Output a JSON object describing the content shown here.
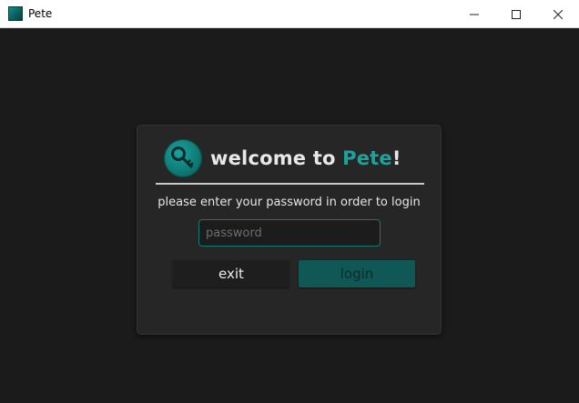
{
  "window": {
    "title": "Pete",
    "icon": "app-icon",
    "controls": [
      "minimize-icon",
      "maximize-icon",
      "close-icon"
    ]
  },
  "login_card": {
    "logo_icon": "key-icon",
    "welcome_prefix": "welcome to ",
    "brand_name": "Pete",
    "welcome_suffix": "!",
    "instruction": "please enter your password in order to login",
    "password_placeholder": "password",
    "password_value": "",
    "exit_label": "exit",
    "login_label": "login"
  },
  "colors": {
    "background": "#1b1b1b",
    "card": "#262626",
    "accent": "#1fa29b",
    "login_button": "#0f5855"
  }
}
